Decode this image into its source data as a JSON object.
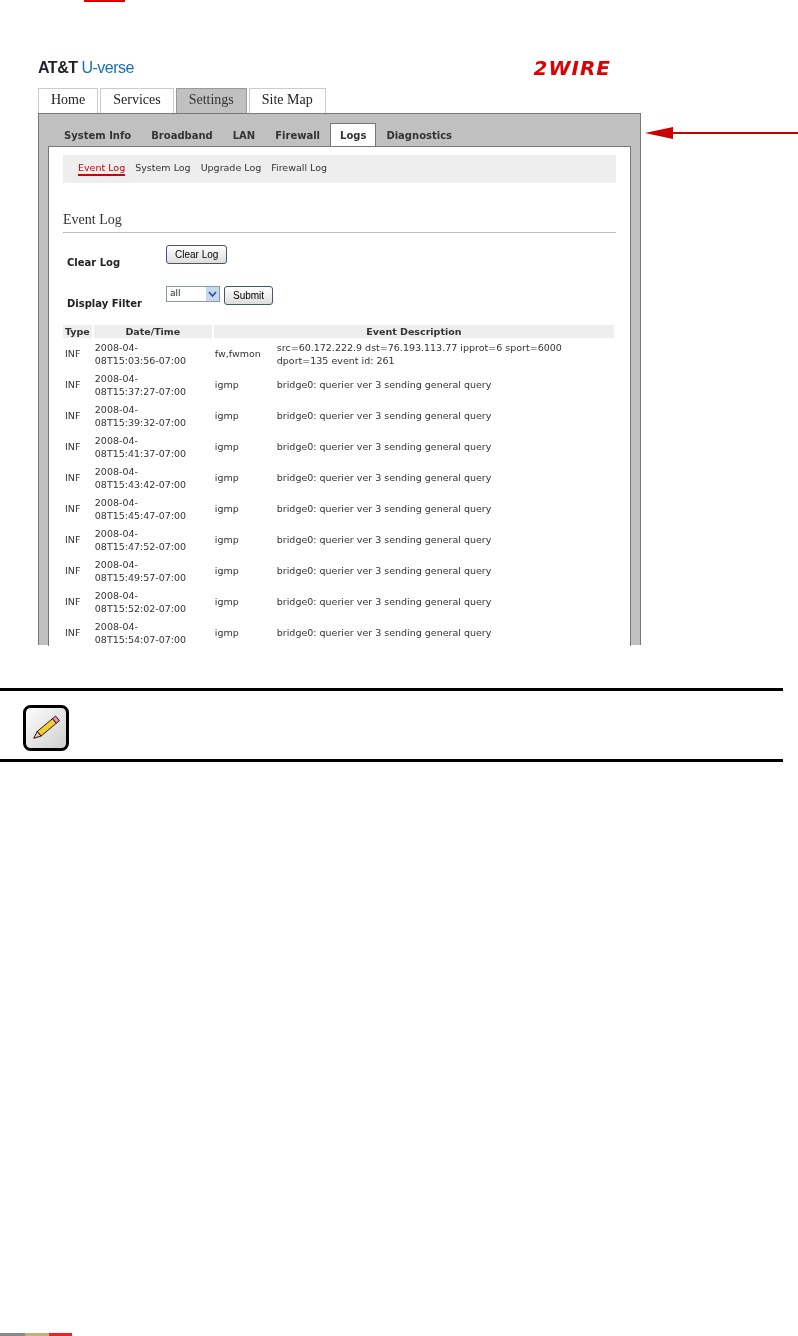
{
  "brand": {
    "left_logo": [
      "AT&T",
      "U-verse"
    ],
    "right_logo": "2WIRE"
  },
  "main_tabs": [
    {
      "label": "Home",
      "selected": false
    },
    {
      "label": "Services",
      "selected": false
    },
    {
      "label": "Settings",
      "selected": true
    },
    {
      "label": "Site Map",
      "selected": false
    }
  ],
  "sub_tabs": [
    {
      "label": "System Info",
      "selected": false
    },
    {
      "label": "Broadband",
      "selected": false
    },
    {
      "label": "LAN",
      "selected": false
    },
    {
      "label": "Firewall",
      "selected": false
    },
    {
      "label": "Logs",
      "selected": true
    },
    {
      "label": "Diagnostics",
      "selected": false
    }
  ],
  "log_nav": [
    {
      "label": "Event Log",
      "selected": true
    },
    {
      "label": "System Log",
      "selected": false
    },
    {
      "label": "Upgrade Log",
      "selected": false
    },
    {
      "label": "Firewall Log",
      "selected": false
    }
  ],
  "section_title": "Event Log",
  "clear_log": {
    "label": "Clear Log",
    "button": "Clear Log"
  },
  "display_filter": {
    "label": "Display Filter",
    "value": "all",
    "button": "Submit"
  },
  "table": {
    "columns": [
      "Type",
      "Date/Time",
      "Event Description"
    ],
    "rows": [
      {
        "type": "INF",
        "datetime": "2008-04-\n08T15:03:56-07:00",
        "source": "fw,fwmon",
        "description": "src=60.172.222.9 dst=76.193.113.77 ipprot=6 sport=6000 dport=135 event id: 261"
      },
      {
        "type": "INF",
        "datetime": "2008-04-\n08T15:37:27-07:00",
        "source": "igmp",
        "description": "bridge0: querier ver 3 sending general query"
      },
      {
        "type": "INF",
        "datetime": "2008-04-\n08T15:39:32-07:00",
        "source": "igmp",
        "description": "bridge0: querier ver 3 sending general query"
      },
      {
        "type": "INF",
        "datetime": "2008-04-\n08T15:41:37-07:00",
        "source": "igmp",
        "description": "bridge0: querier ver 3 sending general query"
      },
      {
        "type": "INF",
        "datetime": "2008-04-\n08T15:43:42-07:00",
        "source": "igmp",
        "description": "bridge0: querier ver 3 sending general query"
      },
      {
        "type": "INF",
        "datetime": "2008-04-\n08T15:45:47-07:00",
        "source": "igmp",
        "description": "bridge0: querier ver 3 sending general query"
      },
      {
        "type": "INF",
        "datetime": "2008-04-\n08T15:47:52-07:00",
        "source": "igmp",
        "description": "bridge0: querier ver 3 sending general query"
      },
      {
        "type": "INF",
        "datetime": "2008-04-\n08T15:49:57-07:00",
        "source": "igmp",
        "description": "bridge0: querier ver 3 sending general query"
      },
      {
        "type": "INF",
        "datetime": "2008-04-\n08T15:52:02-07:00",
        "source": "igmp",
        "description": "bridge0: querier ver 3 sending general query"
      },
      {
        "type": "INF",
        "datetime": "2008-04-\n08T15:54:07-07:00",
        "source": "igmp",
        "description": "bridge0: querier ver 3 sending general query"
      }
    ]
  }
}
